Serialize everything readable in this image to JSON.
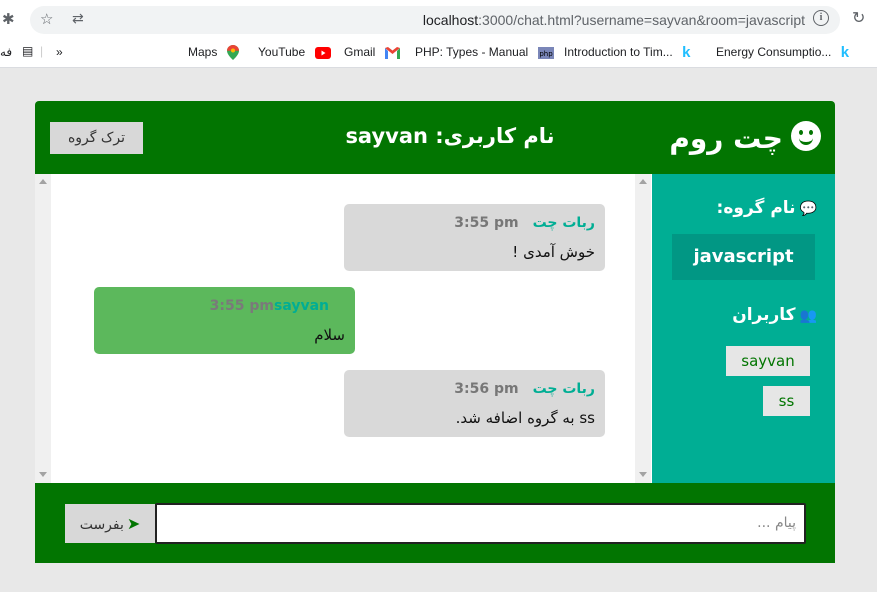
{
  "browser": {
    "url_host": "localhost",
    "url_rest": ":3000/chat.html?username=sayvan&room=javascript",
    "bookmarks": [
      {
        "label": "Maps",
        "icon": "maps-pin-icon"
      },
      {
        "label": "YouTube",
        "icon": "youtube-icon"
      },
      {
        "label": "Gmail",
        "icon": "gmail-icon"
      },
      {
        "label": "PHP: Types - Manual",
        "icon": "php-icon"
      },
      {
        "label": "Introduction to Tim...",
        "icon": "k-icon"
      },
      {
        "label": "Energy Consumptio...",
        "icon": "k-icon"
      }
    ],
    "overflow_label": "»",
    "left_cut_label": "فه"
  },
  "header": {
    "brand": "چت روم",
    "user_label": "نام کاربری: sayvan",
    "leave_button": "ترک گروه"
  },
  "sidebar": {
    "room_title": "نام گروه:",
    "room_name": "javascript",
    "users_title": "کاربران",
    "users": [
      "sayvan",
      "ss"
    ]
  },
  "messages": [
    {
      "sender": "ربات چت",
      "time": "3:55 pm",
      "text": "خوش آمدی !",
      "type": "bot"
    },
    {
      "sender": "sayvan",
      "time": "3:55 pm",
      "text": "سلام",
      "type": "me"
    },
    {
      "sender": "ربات چت",
      "time": "3:56 pm",
      "text": "ss به گروه اضافه شد.",
      "type": "bot"
    }
  ],
  "footer": {
    "input_placeholder": "پیام ...",
    "send_button": "بفرست"
  },
  "colors": {
    "header_green": "#027501",
    "sidebar_teal": "#00ae94",
    "my_message": "#5cb85c",
    "bot_message": "#d9d9d9"
  }
}
